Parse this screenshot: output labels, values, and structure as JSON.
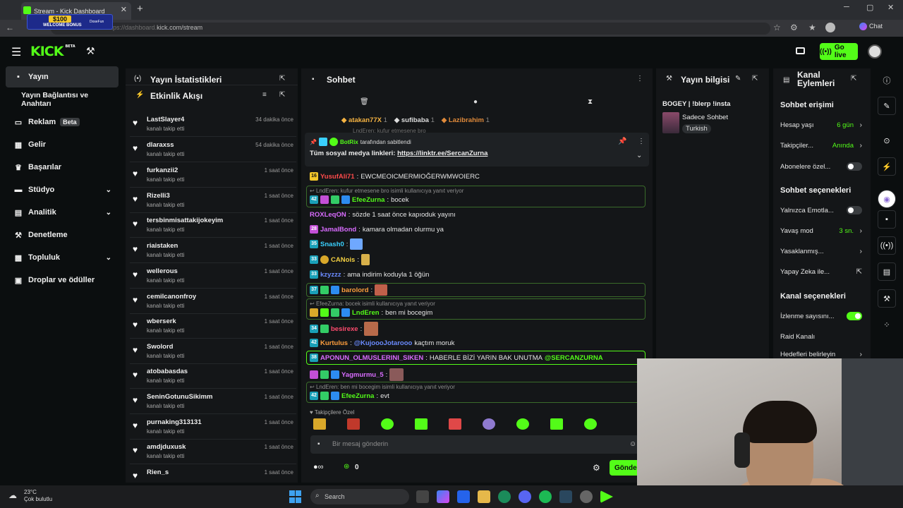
{
  "browser": {
    "tab_title": "Stream - Kick Dashboard",
    "url": "kick.com/stream",
    "url_prefix": "https://dashboard.",
    "chat_button": "Chat",
    "promo": {
      "amount": "$100",
      "text": "WELCOME BONUS",
      "brand": "DoseFun"
    }
  },
  "header": {
    "logo": "KICK",
    "logo_beta": "BETA",
    "go_live": "Go live"
  },
  "sidebar": {
    "items": [
      {
        "label": "Yayın",
        "icon": "broadcast-icon"
      },
      {
        "label": "Yayın Bağlantısı ve Anahtarı",
        "icon": ""
      },
      {
        "label": "Reklam",
        "icon": "ad-icon",
        "badge": "Beta"
      },
      {
        "label": "Gelir",
        "icon": "revenue-icon"
      },
      {
        "label": "Başarılar",
        "icon": "trophy-icon"
      },
      {
        "label": "Stüdyo",
        "icon": "studio-icon"
      },
      {
        "label": "Analitik",
        "icon": "analytics-icon"
      },
      {
        "label": "Denetleme",
        "icon": "wrench-icon"
      },
      {
        "label": "Topluluk",
        "icon": "community-icon"
      },
      {
        "label": "Droplar ve ödüller",
        "icon": "gift-icon"
      }
    ]
  },
  "stats": {
    "title": "Yayın İstatistikleri"
  },
  "activity": {
    "title": "Etkinlik Akışı",
    "rows": [
      {
        "name": "LastSlayer4",
        "sub": "kanalı takip etti",
        "time": "34 dakika önce"
      },
      {
        "name": "dlaraxss",
        "sub": "kanalı takip etti",
        "time": "54 dakika önce"
      },
      {
        "name": "furkanzii2",
        "sub": "kanalı takip etti",
        "time": "1 saat önce"
      },
      {
        "name": "Rizelli3",
        "sub": "kanalı takip etti",
        "time": "1 saat önce"
      },
      {
        "name": "tersbinmisattakijokeyim",
        "sub": "kanalı takip etti",
        "time": "1 saat önce"
      },
      {
        "name": "riaistaken",
        "sub": "kanalı takip etti",
        "time": "1 saat önce"
      },
      {
        "name": "wellerous",
        "sub": "kanalı takip etti",
        "time": "1 saat önce"
      },
      {
        "name": "cemilcanonfroy",
        "sub": "kanalı takip etti",
        "time": "1 saat önce"
      },
      {
        "name": "wberserk",
        "sub": "kanalı takip etti",
        "time": "1 saat önce"
      },
      {
        "name": "Swolord",
        "sub": "kanalı takip etti",
        "time": "1 saat önce"
      },
      {
        "name": "atobabasdas",
        "sub": "kanalı takip etti",
        "time": "1 saat önce"
      },
      {
        "name": "SeninGotunuSikimm",
        "sub": "kanalı takip etti",
        "time": "1 saat önce"
      },
      {
        "name": "purnaking313131",
        "sub": "kanalı takip etti",
        "time": "1 saat önce"
      },
      {
        "name": "amdjduxusk",
        "sub": "kanalı takip etti",
        "time": "1 saat önce"
      },
      {
        "name": "Rien_s",
        "sub": "",
        "time": "1 saat önce"
      }
    ]
  },
  "chat": {
    "title": "Sohbet",
    "top_gifters": [
      {
        "name": "atakan77X",
        "count": "1"
      },
      {
        "name": "sufibaba",
        "count": "1"
      },
      {
        "name": "Lazibrahim",
        "count": "1"
      }
    ],
    "hidden_line": "LndEren: kufur etmesene bro",
    "pinned": {
      "by": "BotRix",
      "by_suffix": "tarafından sabitlendi",
      "text": "Tüm sosyal medya linkleri:",
      "link": "https://linktr.ee/SercanZurna"
    },
    "messages": [
      {
        "badge": "16",
        "user": "YusufAli71",
        "text": "EWCMEOICMERMIOĞERWMWOIERC",
        "color": "#ff4b4b"
      },
      {
        "reply": "LndEren: kufur etmesene bro isimli kullanıcıya yanıt veriyor",
        "badge": "42",
        "user": "EfeeZurna",
        "text": "bocek",
        "color": "#53fc18"
      },
      {
        "badge": "",
        "user": "ROXLeqON",
        "text": "sözde 1 saat önce kapıoduk yayını",
        "color": "#d96cff"
      },
      {
        "badge": "28",
        "user": "JamalBond",
        "text": "kamara olmadan olurmu ya",
        "color": "#d96cff"
      },
      {
        "badge": "35",
        "user": "Snash0",
        "text": "",
        "color": "#3ad1ff"
      },
      {
        "badge": "33",
        "user": "CANois",
        "text": "",
        "color": "#f5d142"
      },
      {
        "badge": "33",
        "user": "kzyzzz",
        "text": "ama indirim koduyla 1 öğün",
        "color": "#6b8bff"
      },
      {
        "badge": "37",
        "user": "barolord",
        "text": "",
        "color": "#ff9e3d"
      },
      {
        "reply": "EfeeZurna: bocek isimli kullanıcıya yanıt veriyor",
        "badge": "",
        "user": "LndEren",
        "text": "ben mi bocegim",
        "color": "#53fc18"
      },
      {
        "badge": "34",
        "user": "besirexe",
        "text": "",
        "color": "#ff4b6e"
      },
      {
        "badge": "42",
        "user": "Kurtulus",
        "text": "kaçtım moruk",
        "mention": "@KujoooJotarooo",
        "color": "#ff9e3d"
      },
      {
        "badge": "38",
        "user": "APONUN_OLMUSLERINI_SIKEN",
        "text": "HABERLE BİZİ YARIN BAK UNUTMA",
        "mention": "@SERCANZURNA",
        "color": "#d96cff"
      },
      {
        "badge": "",
        "user": "Yagmurmu_5",
        "text": "",
        "color": "#d96cff"
      },
      {
        "reply": "LndEren: ben mi bocegim isimli kullanıcıya yanıt veriyor",
        "badge": "42",
        "user": "EfeeZurna",
        "text": "evt",
        "color": "#53fc18"
      }
    ],
    "emote_section": "Takipçilere Özel",
    "input_placeholder": "Bir mesaj gönderin",
    "points": "0",
    "send": "Gönder"
  },
  "streaminfo": {
    "title": "Yayın bilgisi",
    "stream_title": "BOGEY | !blerp !insta",
    "category": "Sadece Sohbet",
    "tag": "Turkish"
  },
  "channel_actions": {
    "title": "Kanal Eylemleri",
    "sections": [
      {
        "title": "Sohbet erişimi",
        "rows": [
          {
            "label": "Hesap yaşı",
            "value": "6 gün",
            "kind": "arrow"
          },
          {
            "label": "Takipçiler...",
            "value": "Anında",
            "kind": "arrow"
          },
          {
            "label": "Abonelere özel...",
            "value": "",
            "kind": "toggle-off"
          }
        ]
      },
      {
        "title": "Sohbet seçenekleri",
        "rows": [
          {
            "label": "Yalnızca Emotla...",
            "value": "",
            "kind": "toggle-off"
          },
          {
            "label": "Yavaş mod",
            "value": "3 sn.",
            "kind": "arrow"
          },
          {
            "label": "Yasaklanmış...",
            "value": "",
            "kind": "arrow"
          },
          {
            "label": "Yapay Zeka ile...",
            "value": "",
            "kind": "external"
          }
        ]
      },
      {
        "title": "Kanal seçenekleri",
        "rows": [
          {
            "label": "İzlenme sayısını...",
            "value": "",
            "kind": "toggle-on"
          },
          {
            "label": "Raid Kanalı",
            "value": "",
            "kind": "none"
          },
          {
            "label": "Hedefleri belirleyin",
            "value": "",
            "kind": "arrow"
          }
        ]
      }
    ]
  },
  "taskbar": {
    "temp": "23°C",
    "weather": "Çok bulutlu",
    "search": "Search"
  },
  "colors": {
    "accent": "#53fc18",
    "panel": "#141618",
    "bg": "#0b0e0f"
  }
}
